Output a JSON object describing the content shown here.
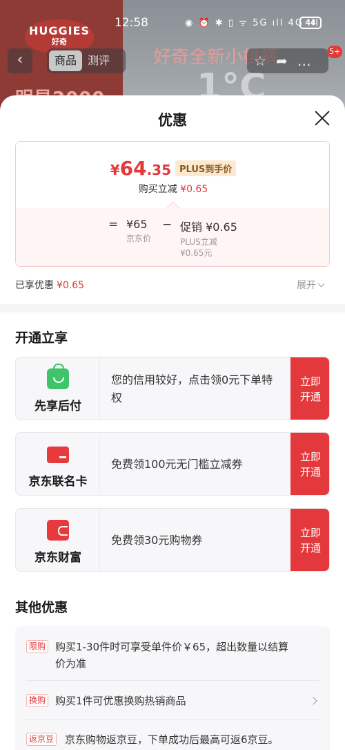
{
  "status_bar": {
    "time": "12:58",
    "icons": "◉ ⏰ ✱ ▯ ᯤ 5G ıll 4G ıll",
    "battery": "44"
  },
  "background": {
    "brand_line1": "HUGGIES",
    "brand_line2": "好奇",
    "promo": "明星2000",
    "title": "好奇全新小桃裤",
    "digit": "1°C",
    "tabs": [
      "商品",
      "测评"
    ],
    "badge": "5+"
  },
  "sheet": {
    "title": "优惠",
    "price_card": {
      "final_currency": "¥",
      "final_int": "64",
      "final_dec": ".35",
      "plus_tag": "PLUS到手价",
      "reduce_label": "购买立减",
      "reduce_value": "¥0.65",
      "eq": "=",
      "minus": "−",
      "jd_price_value": "¥65",
      "jd_price_label": "京东价",
      "promo_value": "促销 ¥0.65",
      "promo_label1": "PLUS立减",
      "promo_label2": "¥0.65元"
    },
    "enjoyed_label": "已享优惠",
    "enjoyed_value": "¥0.65",
    "expand_label": "展开"
  },
  "open_section": {
    "title": "开通立享",
    "offers": [
      {
        "name": "先享后付",
        "icon": "shopping-bag-icon",
        "desc": "您的信用较好，点击领0元下单特权",
        "button": "立即开通"
      },
      {
        "name": "京东联名卡",
        "icon": "credit-card-icon",
        "desc": "免费领100元无门槛立减券",
        "button": "立即开通"
      },
      {
        "name": "京东财富",
        "icon": "wallet-icon",
        "desc": "免费领30元购物券",
        "button": "立即开通"
      }
    ]
  },
  "other_section": {
    "title": "其他优惠",
    "items": [
      {
        "tag": "限购",
        "text": "购买1-30件时可享受单件价￥65，超出数量以结算价为准"
      },
      {
        "tag": "换购",
        "text": "购买1件可优惠换购热销商品"
      },
      {
        "tag": "返京豆",
        "text": "京东购物返京豆，下单成功后最高可返6京豆。"
      }
    ]
  },
  "colors": {
    "accent_red": "#e4393c",
    "plus_gold": "#8a5a1e",
    "green": "#3fc46b"
  }
}
